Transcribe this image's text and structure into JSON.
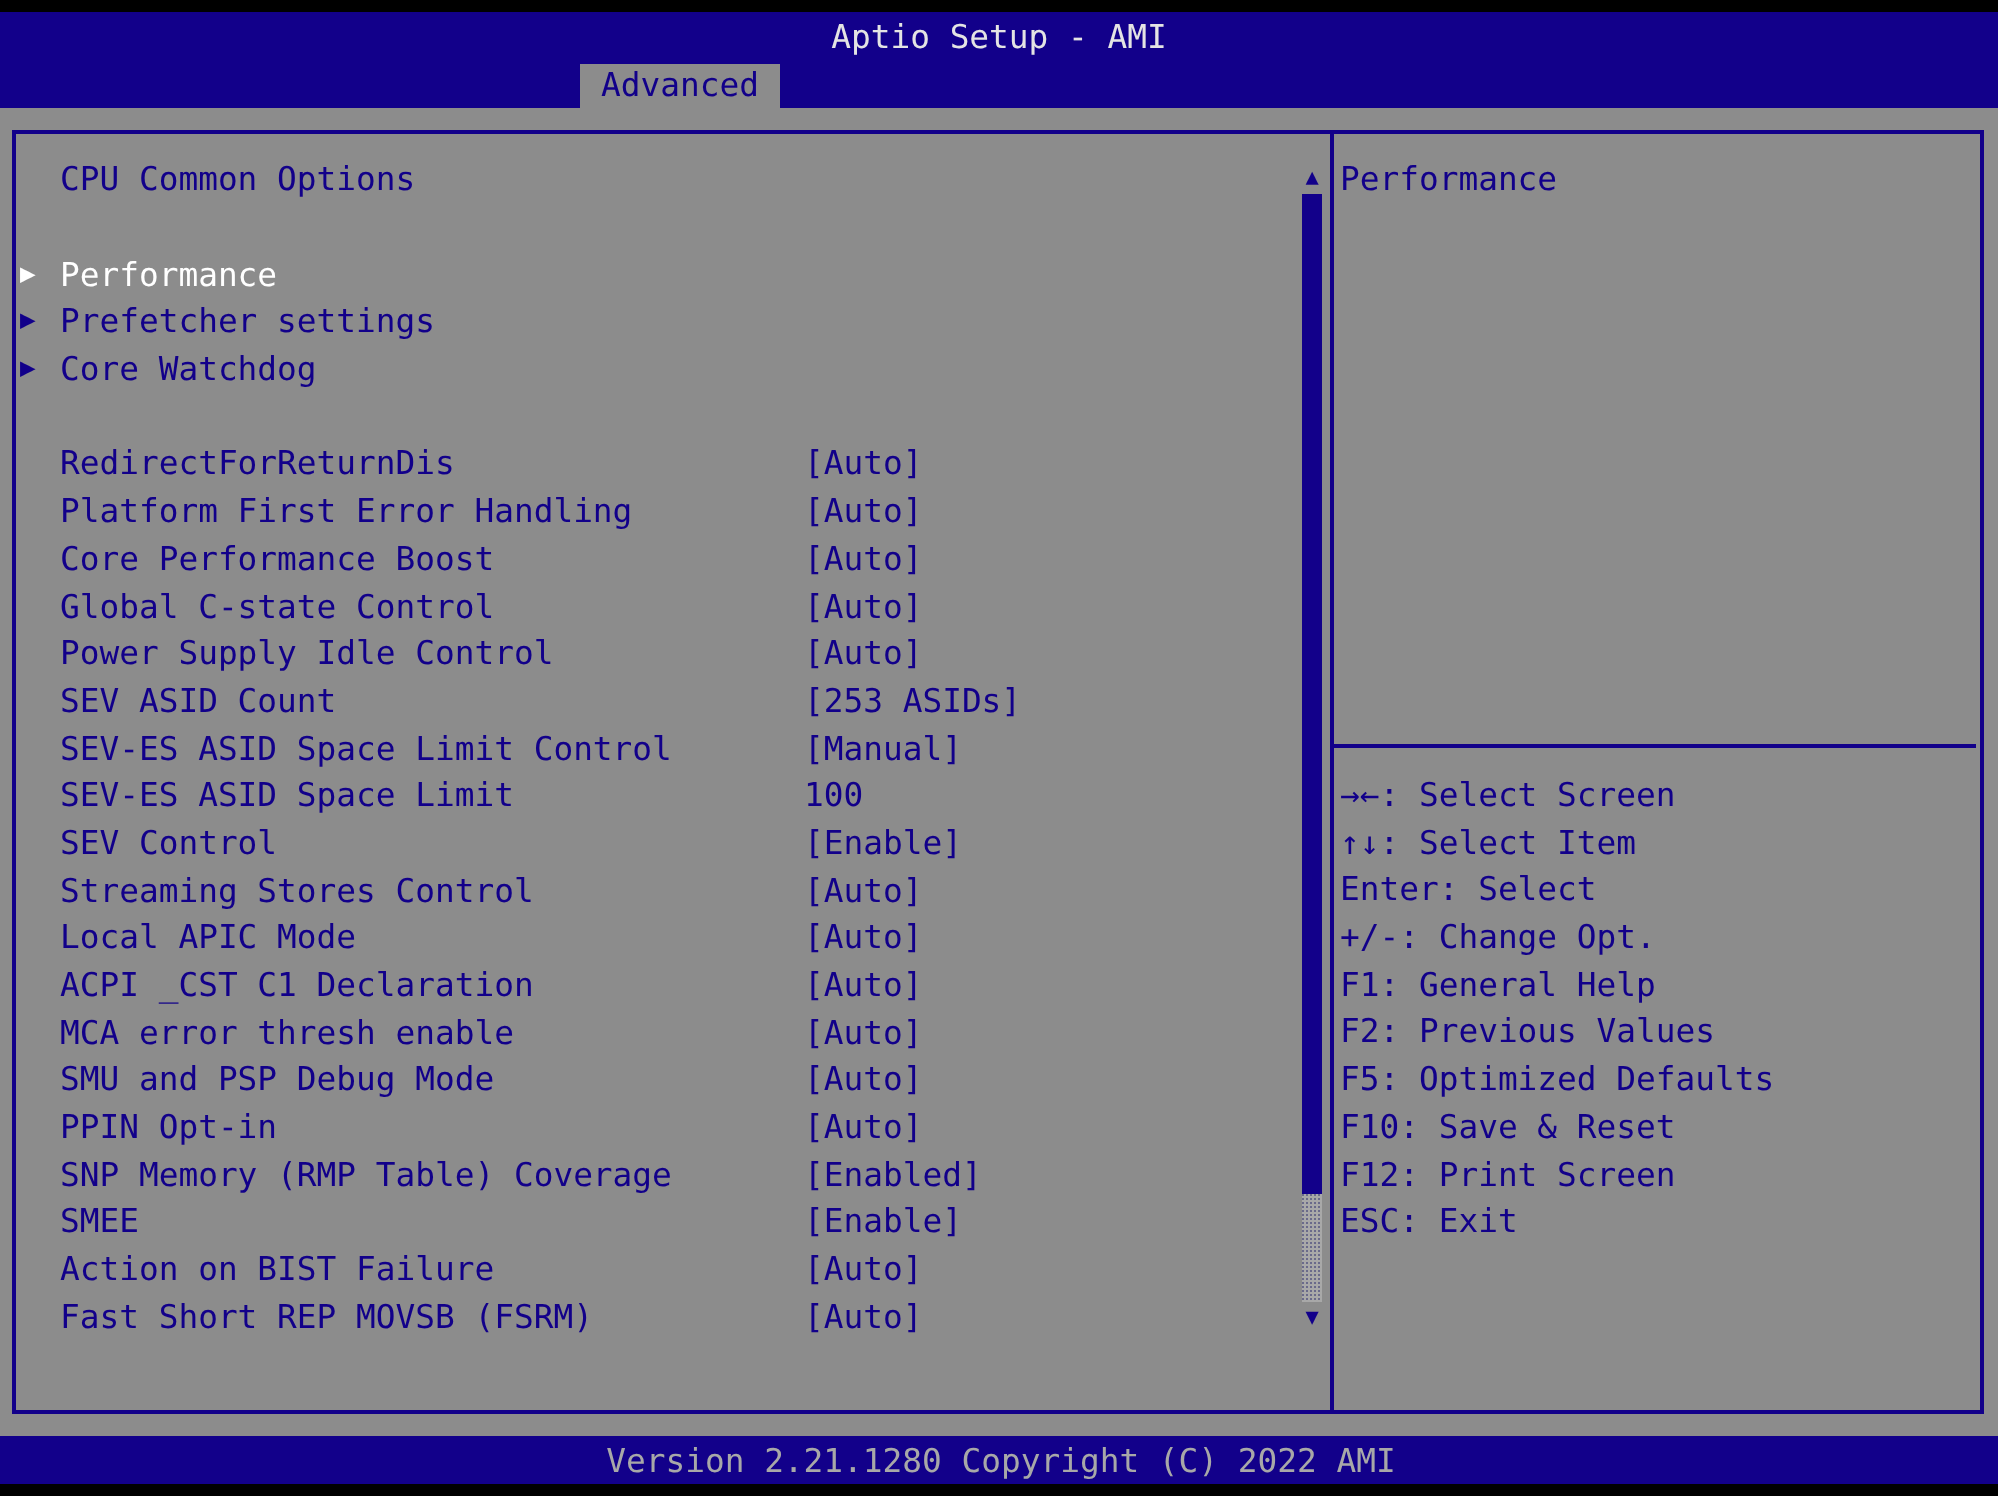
{
  "window": {
    "title": "Aptio Setup - AMI"
  },
  "tabs": [
    {
      "label": "Advanced",
      "selected": true
    }
  ],
  "page_title": "CPU Common Options",
  "submenus": [
    {
      "marker": "▶",
      "label": "Performance",
      "selected": true
    },
    {
      "marker": "▶",
      "label": "Prefetcher settings",
      "selected": false
    },
    {
      "marker": "▶",
      "label": "Core Watchdog",
      "selected": false
    }
  ],
  "settings": [
    {
      "label": "RedirectForReturnDis",
      "value": "[Auto]"
    },
    {
      "label": "Platform First Error Handling",
      "value": "[Auto]"
    },
    {
      "label": "Core Performance Boost",
      "value": "[Auto]"
    },
    {
      "label": "Global C-state Control",
      "value": "[Auto]"
    },
    {
      "label": "Power Supply Idle Control",
      "value": "[Auto]"
    },
    {
      "label": "SEV ASID Count",
      "value": "[253 ASIDs]"
    },
    {
      "label": "SEV-ES ASID Space Limit Control",
      "value": "[Manual]"
    },
    {
      "label": "SEV-ES ASID Space Limit",
      "value": "100"
    },
    {
      "label": "SEV Control",
      "value": "[Enable]"
    },
    {
      "label": "Streaming Stores Control",
      "value": "[Auto]"
    },
    {
      "label": "Local APIC Mode",
      "value": "[Auto]"
    },
    {
      "label": "ACPI _CST C1 Declaration",
      "value": "[Auto]"
    },
    {
      "label": "MCA error thresh enable",
      "value": "[Auto]"
    },
    {
      "label": "SMU and PSP Debug Mode",
      "value": "[Auto]"
    },
    {
      "label": "PPIN Opt-in",
      "value": "[Auto]"
    },
    {
      "label": "SNP Memory (RMP Table) Coverage",
      "value": "[Enabled]"
    },
    {
      "label": "SMEE",
      "value": "[Enable]"
    },
    {
      "label": "Action on BIST Failure",
      "value": "[Auto]"
    },
    {
      "label": "Fast Short REP MOVSB (FSRM)",
      "value": "[Auto]"
    }
  ],
  "scrollbar": {
    "up": "▲",
    "down": "▼"
  },
  "help": {
    "description": "Performance",
    "keys": [
      "→←: Select Screen",
      "↑↓: Select Item",
      "Enter: Select",
      "+/-: Change Opt.",
      "F1: General Help",
      "F2: Previous Values",
      "F5: Optimized Defaults",
      "F10: Save & Reset",
      "F12: Print Screen",
      "ESC: Exit"
    ]
  },
  "footer": "Version 2.21.1280 Copyright (C) 2022 AMI"
}
